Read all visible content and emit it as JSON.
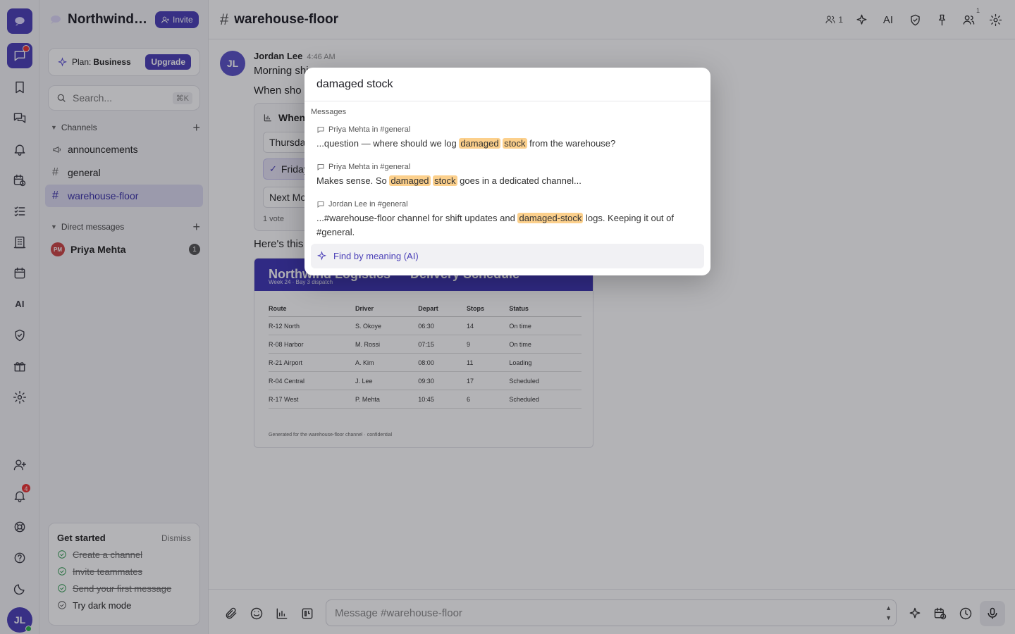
{
  "workspace": {
    "name": "Northwind Logistics",
    "invite_label": "Invite"
  },
  "plan": {
    "prefix": "Plan:",
    "name": "Business",
    "upgrade_label": "Upgrade"
  },
  "sidebar": {
    "search_placeholder": "Search...",
    "search_shortcut": "⌘K",
    "channels_title": "Channels",
    "channels": [
      {
        "name": "announcements",
        "icon": "megaphone-icon"
      },
      {
        "name": "general",
        "icon": "hash-icon"
      },
      {
        "name": "warehouse-floor",
        "icon": "hash-icon",
        "active": true
      }
    ],
    "dm_title": "Direct messages",
    "dms": [
      {
        "initials": "PM",
        "name": "Priya Mehta",
        "unread": "1"
      }
    ]
  },
  "rail": {
    "chat_badge": "",
    "notifications_badge": "4",
    "ai_label": "AI",
    "user_initials": "JL"
  },
  "get_started": {
    "title": "Get started",
    "dismiss": "Dismiss",
    "items": [
      {
        "label": "Create a channel",
        "done": true
      },
      {
        "label": "Invite teammates",
        "done": true
      },
      {
        "label": "Send your first message",
        "done": true
      },
      {
        "label": "Try dark mode",
        "done": false
      }
    ]
  },
  "header": {
    "channel": "warehouse-floor",
    "member_count": "1",
    "ai_label": "AI",
    "members_sup": "1"
  },
  "message": {
    "author_initials": "JL",
    "author": "Jordan Lee",
    "time": "4:46 AM",
    "line1": "Morning shi",
    "line2": "When sho",
    "line3": "Here's this",
    "poll": {
      "title": "When",
      "options": [
        "Thursda",
        "Friday",
        "Next Mo"
      ],
      "selected_index": 1,
      "votes": "1 vote"
    },
    "image": {
      "title": "Northwind Logistics — Delivery Schedule",
      "subtitle": "Week 24 · Bay 3 dispatch",
      "columns": [
        "Route",
        "Driver",
        "Depart",
        "Stops",
        "Status"
      ],
      "rows": [
        [
          "R-12 North",
          "S. Okoye",
          "06:30",
          "14",
          "On time"
        ],
        [
          "R-08 Harbor",
          "M. Rossi",
          "07:15",
          "9",
          "On time"
        ],
        [
          "R-21 Airport",
          "A. Kim",
          "08:00",
          "11",
          "Loading"
        ],
        [
          "R-04 Central",
          "J. Lee",
          "09:30",
          "17",
          "Scheduled"
        ],
        [
          "R-17 West",
          "P. Mehta",
          "10:45",
          "6",
          "Scheduled"
        ]
      ],
      "footer": "Generated for the warehouse-floor channel · confidential"
    }
  },
  "composer": {
    "placeholder": "Message #warehouse-floor"
  },
  "search_modal": {
    "query": "damaged stock",
    "group_label": "Messages",
    "results": [
      {
        "meta": "Priya Mehta in #general",
        "pre": "...question — where should we log ",
        "h1": "damaged",
        "mid": " ",
        "h2": "stock",
        "post": " from the warehouse?"
      },
      {
        "meta": "Priya Mehta in #general",
        "pre": "Makes sense. So ",
        "h1": "damaged",
        "mid": " ",
        "h2": "stock",
        "post": " goes in a dedicated channel..."
      },
      {
        "meta": "Jordan Lee in #general",
        "pre": "...#warehouse-floor channel for shift updates and ",
        "h1": "damaged-stock",
        "mid": "",
        "h2": "",
        "post": " logs. Keeping it out of #general."
      }
    ],
    "ai_action": "Find by meaning (AI)"
  },
  "colors": {
    "accent": "#4a3fb7",
    "highlight": "#fcd08c",
    "badge": "#e33333"
  }
}
